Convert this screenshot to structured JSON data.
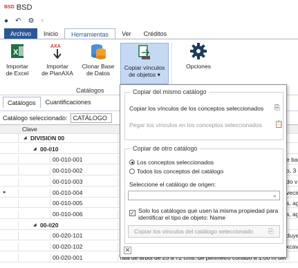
{
  "app": {
    "logo": "BSD",
    "title": "BSD"
  },
  "qat": {
    "icons": [
      "record-icon",
      "undo-icon",
      "gear-icon",
      "dropdown-icon"
    ]
  },
  "tabs": [
    {
      "label": "Archivo"
    },
    {
      "label": "Inicio"
    },
    {
      "label": "Herramientas"
    },
    {
      "label": "Ver"
    },
    {
      "label": "Créditos"
    }
  ],
  "ribbon": {
    "buttons": [
      {
        "label1": "Importar",
        "label2": "de Excel"
      },
      {
        "label1": "Importar",
        "label2": "de PlanAXA"
      },
      {
        "label1": "Clonar Base",
        "label2": "de Datos"
      },
      {
        "label1": "Copiar vínculos",
        "label2": "de objetos ▾"
      },
      {
        "label1": "Opciones",
        "label2": ""
      }
    ],
    "group_label": "Catálogos",
    "axa_text": "AXA"
  },
  "subtabs": [
    {
      "label": "Catálogos"
    },
    {
      "label": "Cuantificaciones"
    }
  ],
  "catalog": {
    "label": "Catálogo seleccionado:",
    "value": "CATÁLOGO"
  },
  "grid": {
    "header": "Clave",
    "rows": [
      {
        "code": "DIVISION 00",
        "desc": "",
        "kind": "division"
      },
      {
        "code": "00-010",
        "desc": "",
        "kind": "group"
      },
      {
        "code": "00-010-001",
        "desc": "e ba",
        "kind": "item"
      },
      {
        "code": "00-010-002",
        "desc": "o, 3 c",
        "kind": "item"
      },
      {
        "code": "00-010-003",
        "desc": "do v",
        "kind": "item"
      },
      {
        "code": "00-010-004",
        "desc": "vecin",
        "kind": "item"
      },
      {
        "code": "00-010-005",
        "desc": "s, ag",
        "kind": "item"
      },
      {
        "code": "00-010-006",
        "desc": "s, ag",
        "kind": "item"
      },
      {
        "code": "00-020",
        "desc": "",
        "kind": "group"
      },
      {
        "code": "00-020-101",
        "desc": "duye",
        "kind": "item"
      },
      {
        "code": "00-020-102",
        "desc": "xcav",
        "kind": "item"
      },
      {
        "code": "00-020-001",
        "desc": "Tala de arbol de 25 a 72 cms. de perimetro cortado a 1.00 m del",
        "kind": "item"
      }
    ]
  },
  "popup": {
    "section1": {
      "legend": "Copiar del mismo catálogo",
      "copy_label": "Copiar los vínculos de los conceptos seleccionados",
      "paste_label": "Pegar los vínculos en los conceptos seleccionados"
    },
    "section2": {
      "legend": "Copiar de otro catálogo",
      "radio1": "Los conceptos seleccionados",
      "radio2": "Todos los conceptos del catálogo",
      "origin_label": "Seleccione el catálogo de origen:",
      "checkbox_label1": "Solo los catálogos que usen la misma propiedad para",
      "checkbox_label2": "identificar el tipo de objeto: Name",
      "button_label": "Copiar los vínculos del catálogo seleccionado"
    },
    "close_glyph": "✕"
  },
  "colors": {
    "accent": "#2b5797",
    "selected": "#c5daf2"
  }
}
